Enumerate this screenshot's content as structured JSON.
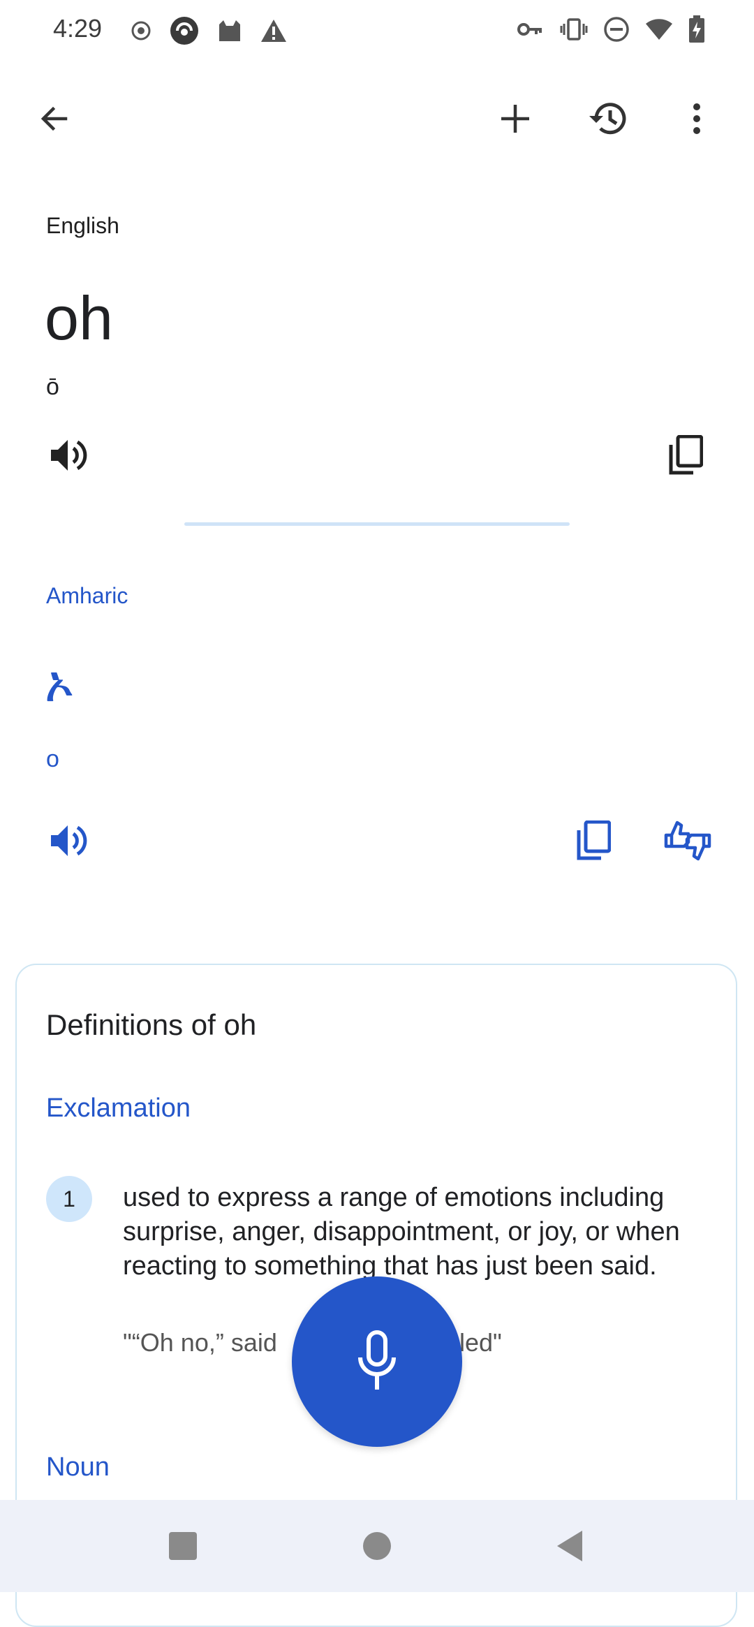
{
  "status_bar": {
    "time": "4:29",
    "left_icons": [
      "record-icon",
      "vpn-app-icon",
      "cat-icon",
      "warning-icon"
    ],
    "right_icons": [
      "key-icon",
      "vibrate-icon",
      "dnd-icon",
      "wifi-icon",
      "battery-charging-icon"
    ]
  },
  "app_bar": {
    "icons": [
      "back-arrow-icon",
      "plus-icon",
      "history-icon",
      "more-vert-icon"
    ]
  },
  "source": {
    "language": "English",
    "text": "oh",
    "transliteration": "ō"
  },
  "target": {
    "language": "Amharic",
    "text": "ኦ",
    "transliteration": "o"
  },
  "definitions": {
    "title": "Definitions of oh",
    "part_of_speech_1": "Exclamation",
    "item_number": "1",
    "item_text": "used to express a range of emotions including surprise, anger, disappointment, or joy, or when reacting to something that has just been said.",
    "example_left": "\"“Oh no,” said",
    "example_right": "led\"",
    "part_of_speech_2": "Noun"
  },
  "colors": {
    "accent": "#2456c9",
    "divider": "#cfe3f7",
    "badge": "#cfe6fb",
    "nav_bg": "#eef1f9"
  }
}
